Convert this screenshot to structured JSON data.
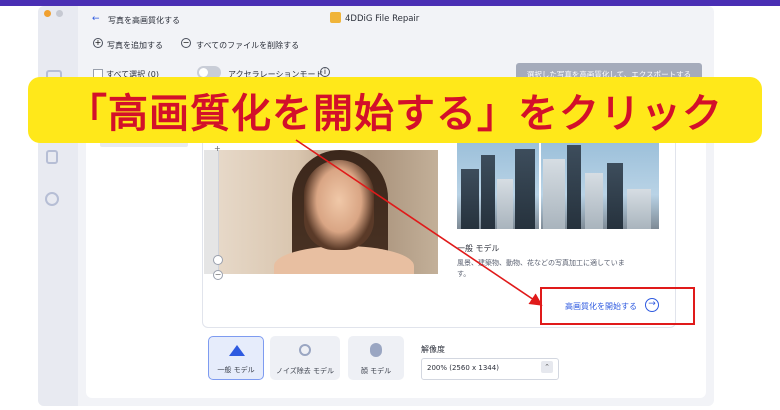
{
  "window": {
    "app_title": "4DDiG File Repair",
    "back_label": "写真を高画質化する"
  },
  "toolbar": {
    "add_photo": "写真を追加する",
    "delete_all": "すべてのファイルを削除する",
    "select_all": "すべて選択 (0)",
    "acceleration": "アクセラレーションモード",
    "export_button": "選択した写真を高画質化して、エクスポートする"
  },
  "banner": {
    "text": "「高画質化を開始する」をクリック"
  },
  "model_preview": {
    "title": "一般 モデル",
    "description": "風景、建築物、動物、花などの写真加工に適しています。",
    "start_button": "高画質化を開始する"
  },
  "models": [
    {
      "label": "一般 モデル",
      "icon": "image-icon",
      "selected": true
    },
    {
      "label": "ノイズ除去 モデル",
      "icon": "noise-icon",
      "selected": false
    },
    {
      "label": "顔 モデル",
      "icon": "face-icon",
      "selected": false
    }
  ],
  "resolution": {
    "label": "解像度",
    "value": "200% (2560 x 1344)"
  },
  "colors": {
    "accent": "#2e5ae0",
    "banner_bg": "#ffe81a",
    "banner_text": "#d3102a",
    "highlight_box": "#e01a1a",
    "arrow": "#e01a1a"
  }
}
